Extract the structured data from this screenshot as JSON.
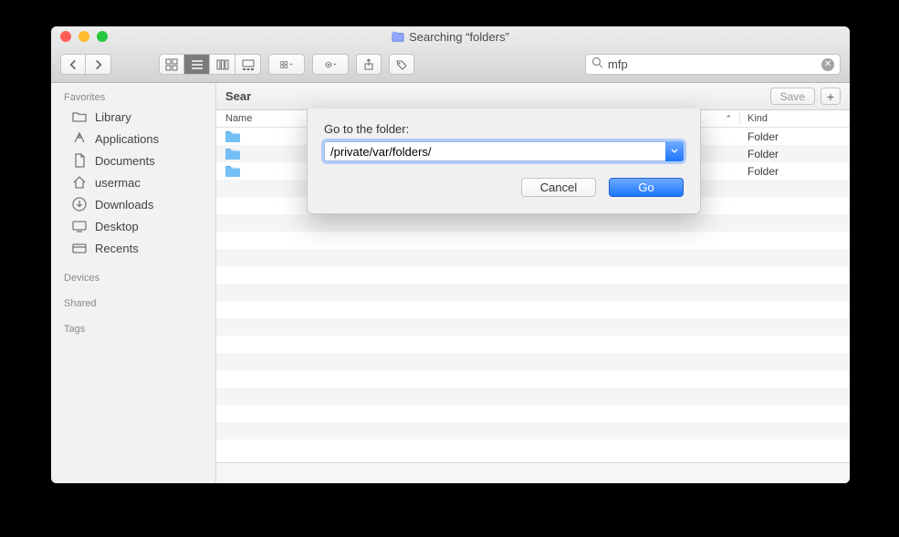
{
  "window": {
    "title": "Searching “folders”"
  },
  "toolbar": {
    "search_value": "mfp"
  },
  "sidebar": {
    "sections": {
      "favorites": "Favorites",
      "devices": "Devices",
      "shared": "Shared",
      "tags": "Tags"
    },
    "items": [
      {
        "label": "Library"
      },
      {
        "label": "Applications"
      },
      {
        "label": "Documents"
      },
      {
        "label": "usermac"
      },
      {
        "label": "Downloads"
      },
      {
        "label": "Desktop"
      },
      {
        "label": "Recents"
      }
    ]
  },
  "searchbar": {
    "prefix": "Sear",
    "save_label": "Save"
  },
  "columns": {
    "name": "Name",
    "kind": "Kind"
  },
  "rows": [
    {
      "kind": "Folder"
    },
    {
      "kind": "Folder"
    },
    {
      "kind": "Folder"
    }
  ],
  "sheet": {
    "label": "Go to the folder:",
    "path": "/private/var/folders/",
    "cancel": "Cancel",
    "go": "Go"
  }
}
